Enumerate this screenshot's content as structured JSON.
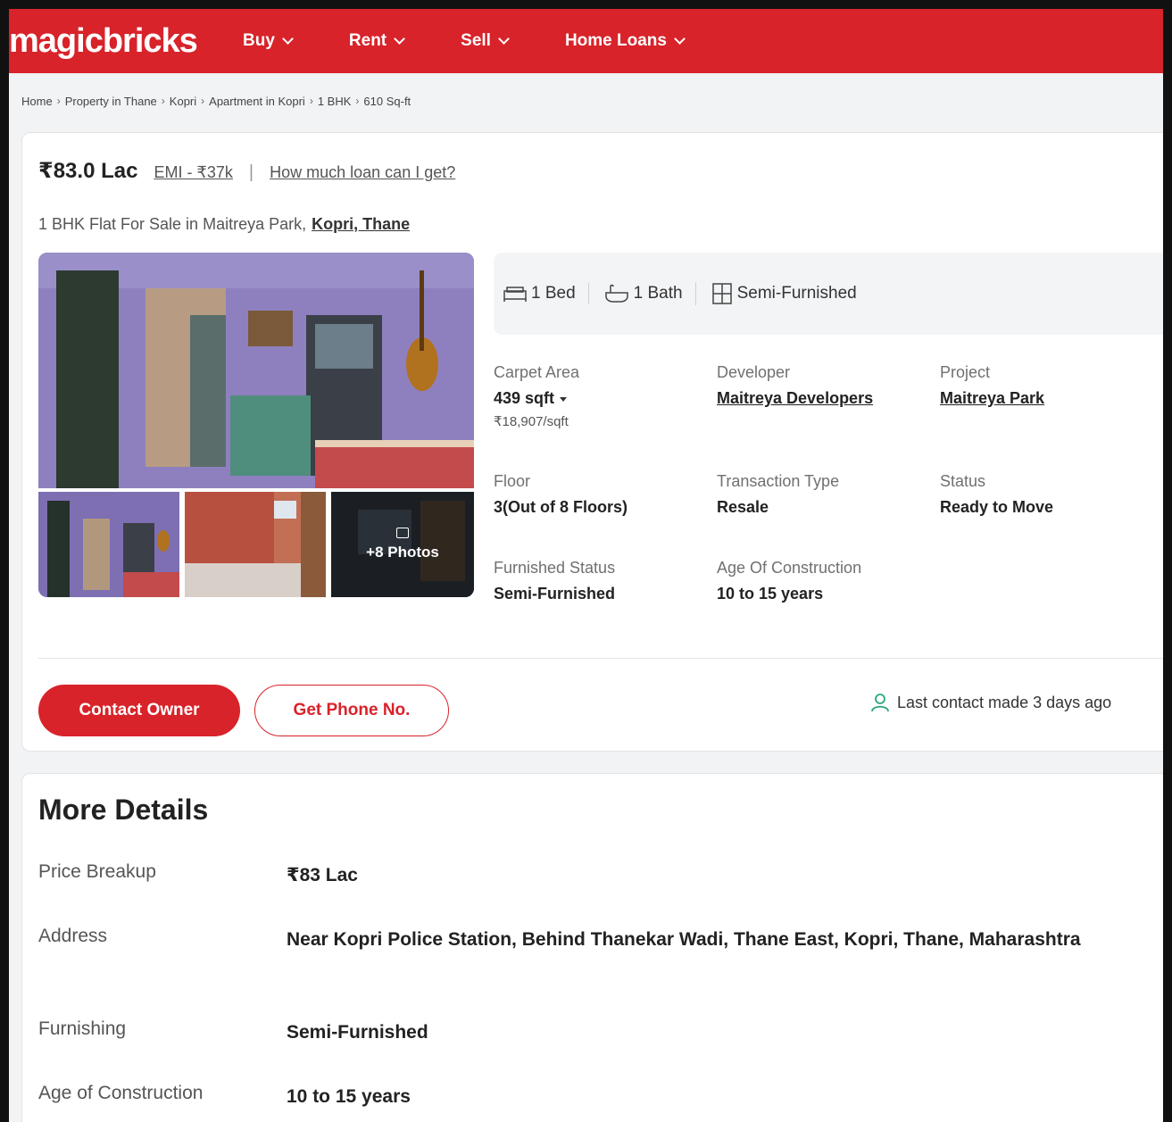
{
  "header": {
    "logo": "magicbricks",
    "nav": [
      "Buy",
      "Rent",
      "Sell",
      "Home Loans"
    ],
    "brand_color": "#d8232a"
  },
  "breadcrumb": [
    "Home",
    "Property in Thane",
    "Kopri",
    "Apartment in Kopri",
    "1 BHK",
    "610 Sq-ft"
  ],
  "listing": {
    "price": "₹83.0 Lac",
    "emi": "EMI - ₹37k",
    "loan_link": "How much loan can I get?",
    "title_prefix": "1 BHK Flat For Sale in Maitreya Park,",
    "title_location": "Kopri, Thane",
    "photos_more": "+8 Photos",
    "amenities": [
      {
        "icon": "bed-icon",
        "label": "1 Bed"
      },
      {
        "icon": "bath-icon",
        "label": "1 Bath"
      },
      {
        "icon": "furnishing-icon",
        "label": "Semi-Furnished"
      }
    ],
    "info": {
      "carpet_area": {
        "label": "Carpet Area",
        "value": "439 sqft",
        "sub": "₹18,907/sqft"
      },
      "developer": {
        "label": "Developer",
        "value": "Maitreya Developers"
      },
      "project": {
        "label": "Project",
        "value": "Maitreya Park"
      },
      "floor": {
        "label": "Floor",
        "value": "3(Out of 8 Floors)"
      },
      "transaction": {
        "label": "Transaction Type",
        "value": "Resale"
      },
      "status": {
        "label": "Status",
        "value": "Ready to Move"
      },
      "furnished": {
        "label": "Furnished Status",
        "value": "Semi-Furnished"
      },
      "age": {
        "label": "Age Of Construction",
        "value": "10 to 15 years"
      }
    },
    "contact_button": "Contact Owner",
    "phone_button": "Get Phone No.",
    "last_contact": "Last contact made 3 days ago"
  },
  "more_details": {
    "title": "More Details",
    "rows": [
      {
        "key": "Price Breakup",
        "value": "₹83 Lac"
      },
      {
        "key": "Address",
        "value": "Near Kopri Police Station, Behind Thanekar Wadi, Thane East, Kopri, Thane, Maharashtra"
      },
      {
        "key": "Furnishing",
        "value": "Semi-Furnished"
      },
      {
        "key": "Age of Construction",
        "value": "10 to 15 years"
      }
    ]
  }
}
